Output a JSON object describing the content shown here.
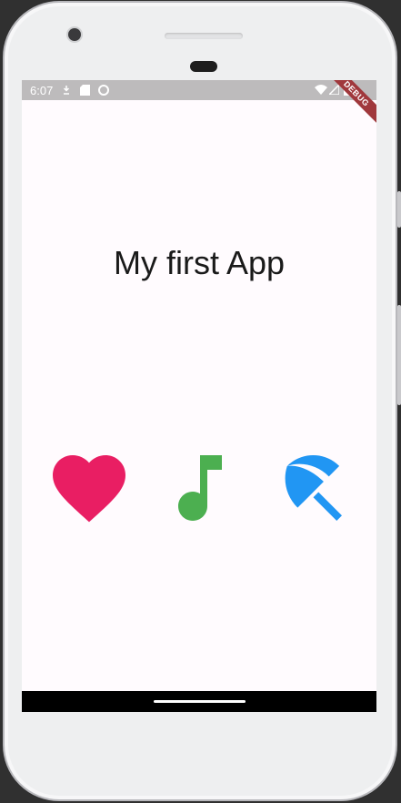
{
  "status_bar": {
    "time": "6:07"
  },
  "debug_banner": "DEBUG",
  "main": {
    "title": "My first App",
    "icons": [
      {
        "name": "favorite",
        "color": "#e91e63"
      },
      {
        "name": "music-note",
        "color": "#4caf50"
      },
      {
        "name": "beach-access",
        "color": "#2196f3"
      }
    ]
  }
}
